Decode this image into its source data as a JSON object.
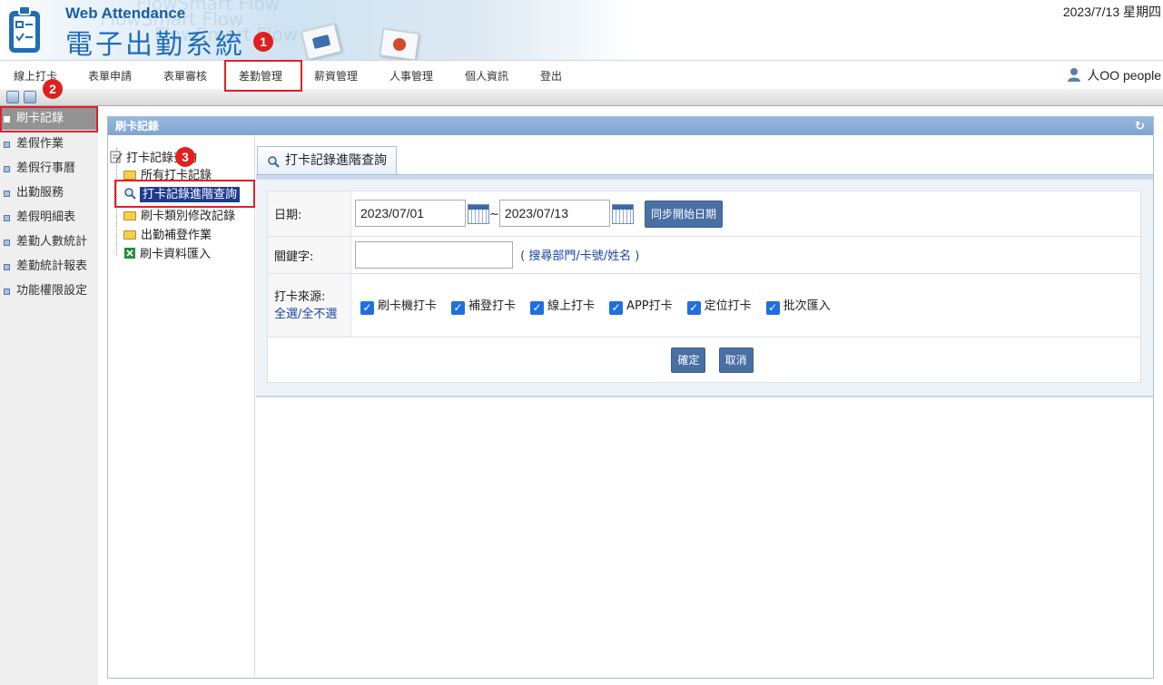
{
  "header": {
    "brand_en": "Web Attendance",
    "brand_zh": "電子出勤系統",
    "watermark": "FlowSmart Flow",
    "date": "2023/7/13 星期四"
  },
  "markers": [
    "1",
    "2",
    "3"
  ],
  "topnav": {
    "items": [
      "線上打卡",
      "表單申請",
      "表單審核",
      "差勤管理",
      "薪資管理",
      "人事管理",
      "個人資訊",
      "登出"
    ],
    "active": "差勤管理",
    "user": "人OO people",
    "user_icon": "person-icon"
  },
  "sidebar": {
    "items": [
      "刷卡記錄",
      "差假作業",
      "差假行事曆",
      "出勤服務",
      "差假明細表",
      "差勤人數統計",
      "差勤統計報表",
      "功能權限設定"
    ],
    "active": "刷卡記錄"
  },
  "panel": {
    "title": "刷卡記錄"
  },
  "tree": {
    "root": "打卡記錄查詢",
    "items": [
      "所有打卡記錄",
      "打卡記錄進階查詢",
      "刷卡類別修改記錄",
      "出勤補登作業",
      "刷卡資料匯入"
    ],
    "selected": "打卡記錄進階查詢"
  },
  "tab": {
    "label": "打卡記錄進階查詢",
    "icon": "search-icon"
  },
  "form": {
    "date_label": "日期:",
    "date_from": "2023/07/01",
    "date_sep": "~",
    "date_to": "2023/07/13",
    "sync_button": "同步開始日期",
    "keyword_label": "關鍵字:",
    "keyword_value": "",
    "keyword_hint": "( 搜尋部門/卡號/姓名 )",
    "source_label": "打卡來源:",
    "select_all": "全選/全不選",
    "sources": [
      "刷卡機打卡",
      "補登打卡",
      "線上打卡",
      "APP打卡",
      "定位打卡",
      "批次匯入"
    ],
    "confirm": "確定",
    "cancel": "取消"
  },
  "colors": {
    "accent": "#4a6fa5",
    "highlight": "#e0202a",
    "checkbox": "#1f6fe0"
  }
}
